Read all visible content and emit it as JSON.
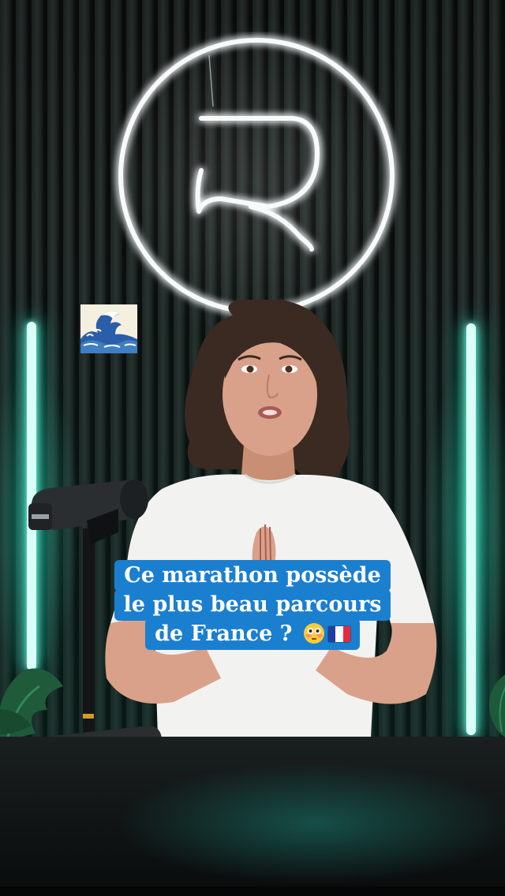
{
  "video": {
    "caption": {
      "line1": "Ce marathon possède",
      "line2": "le plus beau parcours",
      "line3_text": "de France ?"
    },
    "caption_emojis": [
      "flushed-face-icon",
      "france-flag-icon"
    ],
    "overlay_emoji": "water-wave-icon",
    "logo": "neon-r-logo",
    "colors": {
      "caption_background": "#1b7fd0",
      "caption_text": "#ffffff",
      "neon_white": "#f4f4f4",
      "neon_teal": "#2fd6b6"
    }
  }
}
